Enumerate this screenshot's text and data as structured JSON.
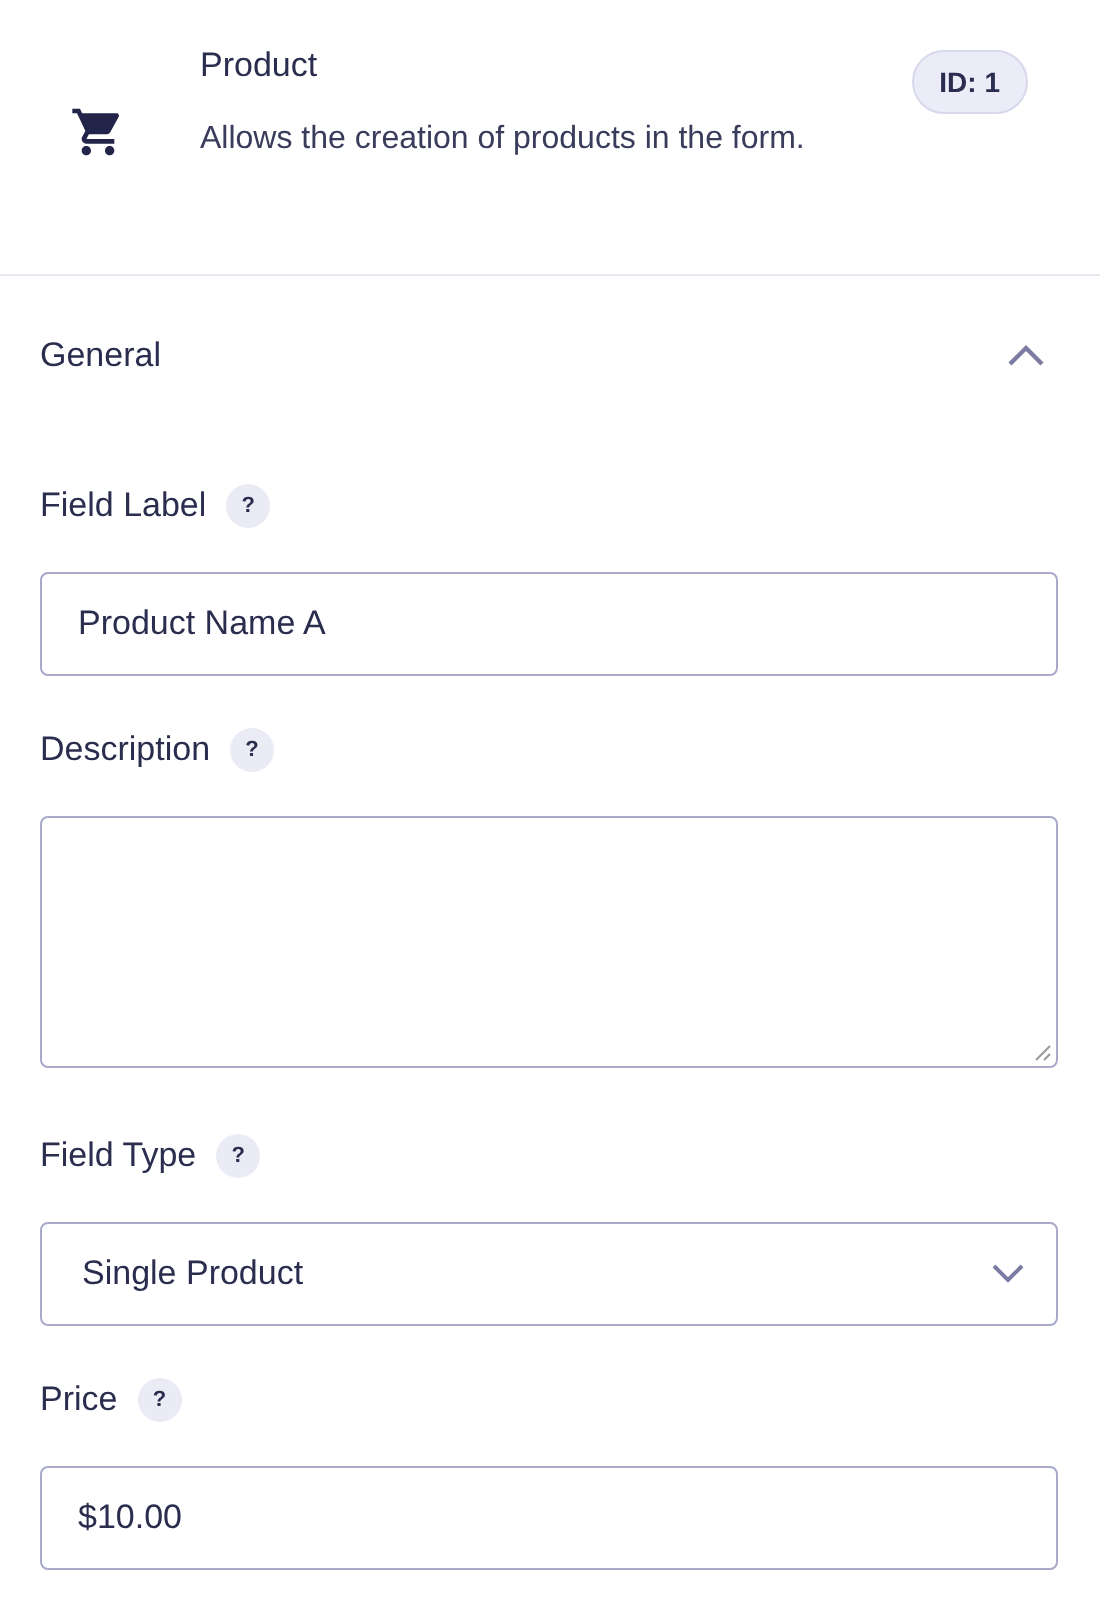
{
  "header": {
    "title": "Product",
    "description": "Allows the creation of products in the form.",
    "badge": "ID: 1"
  },
  "section": {
    "title": "General",
    "expanded": true,
    "fields": [
      {
        "kind": "text",
        "label": "Field Label",
        "help": "?",
        "value": "Product Name A"
      },
      {
        "kind": "textarea",
        "label": "Description",
        "help": "?"
      },
      {
        "kind": "select",
        "label": "Field Type",
        "help": "?",
        "value": "Single Product"
      },
      {
        "kind": "text",
        "label": "Price",
        "help": "?",
        "value": "$10.00"
      }
    ]
  }
}
